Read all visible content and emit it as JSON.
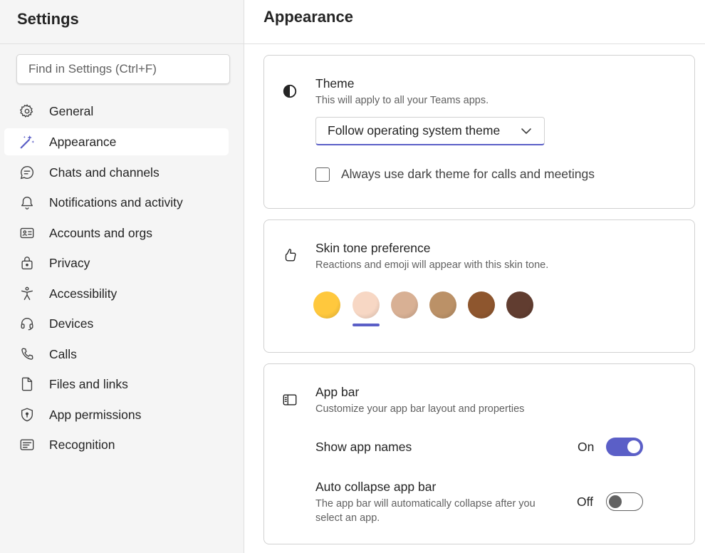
{
  "sidebar": {
    "title": "Settings",
    "search_placeholder": "Find in Settings (Ctrl+F)",
    "items": [
      {
        "label": "General",
        "icon": "gear-icon"
      },
      {
        "label": "Appearance",
        "icon": "magic-wand-icon",
        "active": true
      },
      {
        "label": "Chats and channels",
        "icon": "chat-bubble-icon"
      },
      {
        "label": "Notifications and activity",
        "icon": "bell-icon"
      },
      {
        "label": "Accounts and orgs",
        "icon": "contact-card-icon"
      },
      {
        "label": "Privacy",
        "icon": "lock-icon"
      },
      {
        "label": "Accessibility",
        "icon": "accessibility-person-icon"
      },
      {
        "label": "Devices",
        "icon": "headset-icon"
      },
      {
        "label": "Calls",
        "icon": "phone-icon"
      },
      {
        "label": "Files and links",
        "icon": "document-icon"
      },
      {
        "label": "App permissions",
        "icon": "shield-icon"
      },
      {
        "label": "Recognition",
        "icon": "text-box-icon"
      }
    ]
  },
  "main": {
    "title": "Appearance",
    "theme": {
      "title": "Theme",
      "subtitle": "This will apply to all your Teams apps.",
      "dropdown_value": "Follow operating system theme",
      "checkbox_label": "Always use dark theme for calls and meetings",
      "checkbox_checked": false
    },
    "skin_tone": {
      "title": "Skin tone preference",
      "subtitle": "Reactions and emoji will appear with this skin tone.",
      "tones": [
        "#ffc83d",
        "#f7d7c4",
        "#d8b094",
        "#bb9167",
        "#8e562e",
        "#613d30"
      ],
      "selected_index": 1
    },
    "app_bar": {
      "title": "App bar",
      "subtitle": "Customize your app bar layout and properties",
      "show_names_label": "Show app names",
      "show_names_state": "On",
      "auto_collapse_label": "Auto collapse app bar",
      "auto_collapse_desc": "The app bar will automatically collapse after you select an app.",
      "auto_collapse_state": "Off"
    }
  },
  "colors": {
    "accent": "#5b5fc7",
    "sidebar_bg": "#f5f5f5"
  }
}
